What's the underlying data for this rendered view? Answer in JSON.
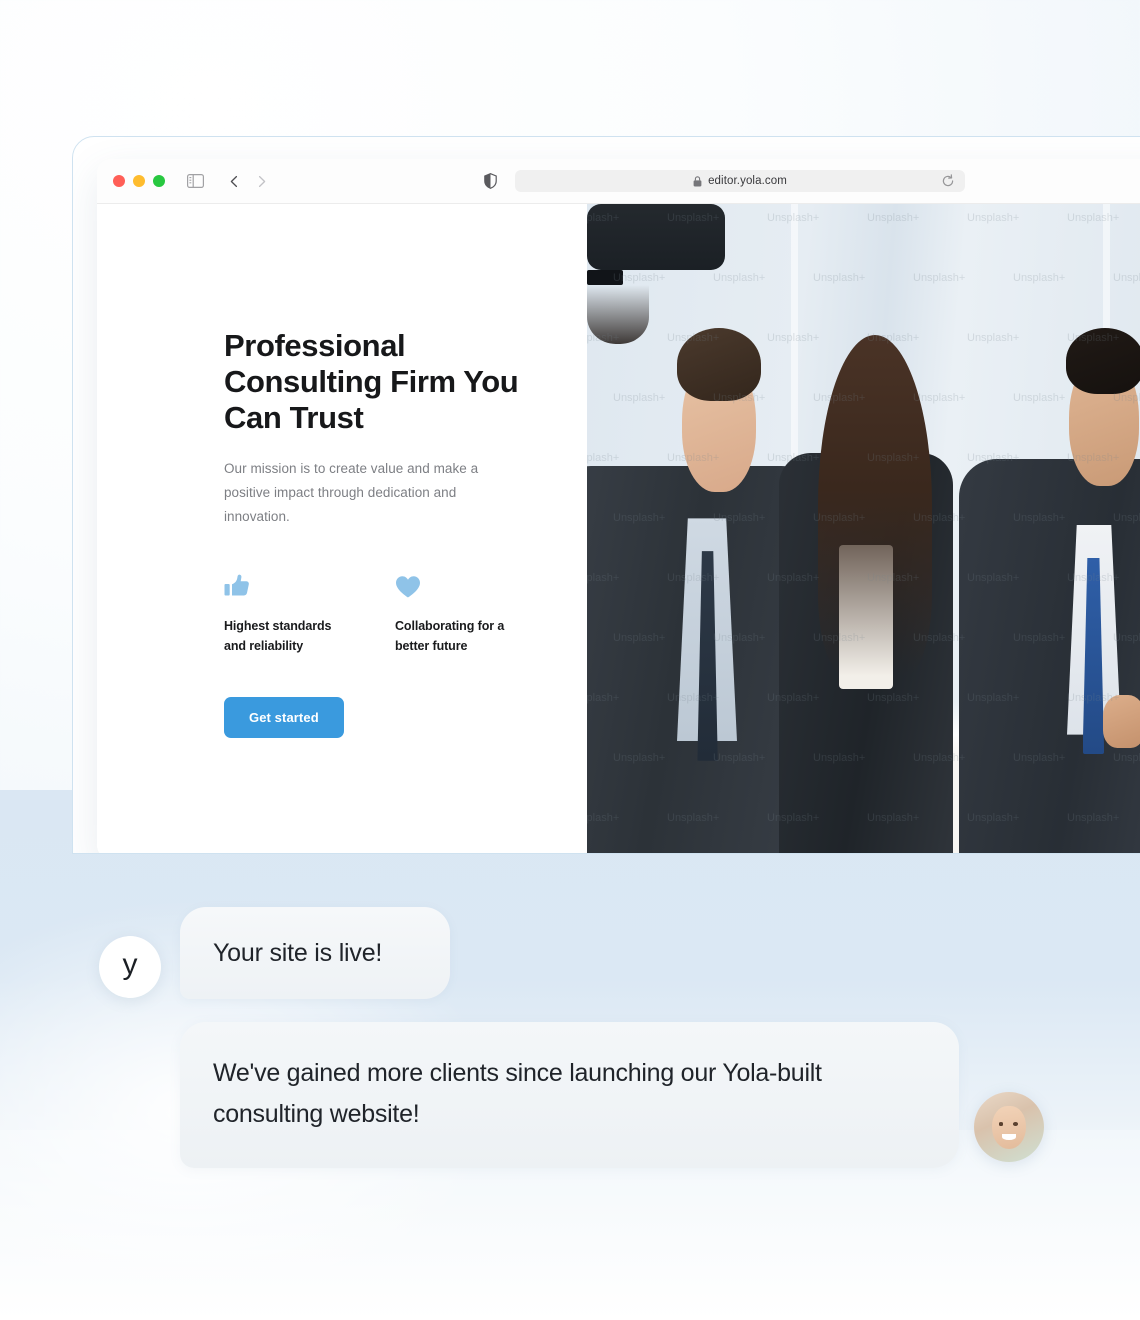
{
  "browser": {
    "url": "editor.yola.com",
    "lock_icon": "lock-icon",
    "reload_icon": "reload-icon",
    "shield_icon": "shield-icon",
    "sidebar_icon": "sidebar-toggle-icon",
    "back_icon": "chevron-left-icon",
    "forward_icon": "chevron-right-icon",
    "traffic_lights": [
      "close-red",
      "minimize-amber",
      "maximize-green"
    ]
  },
  "site": {
    "hero": {
      "title": "Professional Consulting Firm You Can Trust",
      "subtitle": "Our mission is to create value and make a positive impact through dedication and innovation.",
      "cta_label": "Get started"
    },
    "features": [
      {
        "icon": "thumbs-up-icon",
        "label": "Highest standards and reliability"
      },
      {
        "icon": "heart-icon",
        "label": "Collaborating for a better future"
      }
    ],
    "image_watermark": "Unsplash+"
  },
  "chat": {
    "brand_initial": "y",
    "message_1": "Your site is live!",
    "message_2": "We've gained more clients since launching our Yola-built consulting website!"
  },
  "colors": {
    "accent_blue": "#3a9ade",
    "icon_blue": "#8fc3e8",
    "heading": "#17181a",
    "body_text": "#7d7f84",
    "page_bg": "#dae7f3"
  }
}
